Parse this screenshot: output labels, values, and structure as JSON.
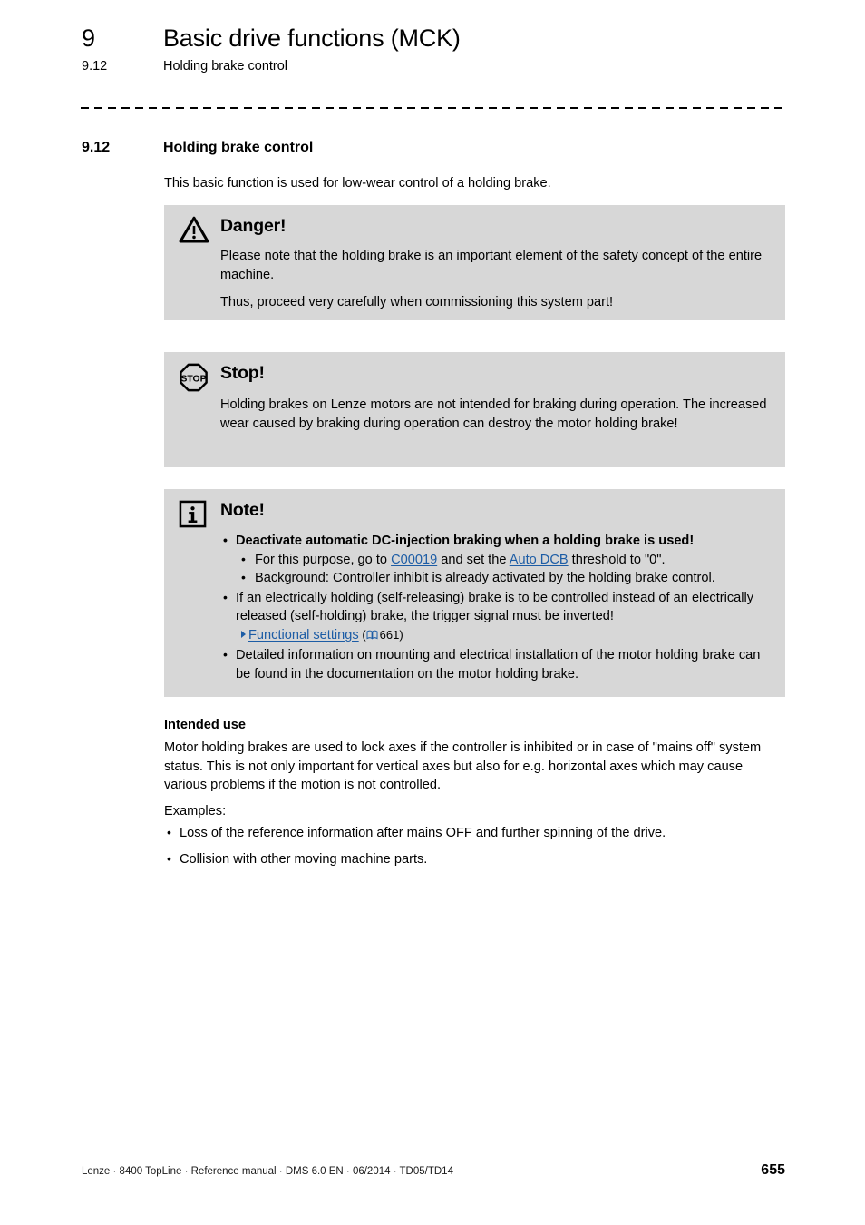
{
  "header": {
    "chapter_number": "9",
    "chapter_title": "Basic drive functions (MCK)",
    "section_number": "9.12",
    "section_title": "Holding brake control"
  },
  "section": {
    "number": "9.12",
    "title": "Holding brake control",
    "intro": "This basic function is used for low-wear control of a holding brake."
  },
  "callouts": {
    "danger": {
      "icon": "warning-triangle-icon",
      "title": "Danger!",
      "paragraphs": [
        "Please note that the holding brake is an important element of the safety concept of the entire machine.",
        "Thus, proceed very carefully when commissioning this system part!"
      ]
    },
    "stop": {
      "icon": "stop-sign-icon",
      "title": "Stop!",
      "paragraphs": [
        "Holding brakes on Lenze motors are not intended for braking during operation. The increased wear caused by braking during operation can destroy the motor holding brake!"
      ]
    },
    "note": {
      "icon": "info-icon",
      "title": "Note!",
      "item1": "Deactivate automatic DC-injection braking when a holding brake is used!",
      "item1_sub1_a": "For this purpose, go to ",
      "item1_sub1_link1": "C00019",
      "item1_sub1_b": " and set the ",
      "item1_sub1_link2": "Auto DCB",
      "item1_sub1_c": " threshold to \"0\".",
      "item1_sub2": "Background: Controller inhibit is already activated by the holding brake control.",
      "item2": "If an electrically holding (self-releasing) brake is to be controlled instead of an electrically released (self-holding) brake, the trigger signal must be inverted!",
      "item2_xref_link": "Functional settings",
      "item2_xref_page": "661",
      "item2_xref_open": "(",
      "item2_xref_close": ")",
      "item3": "Detailed information on mounting and electrical installation of the motor holding brake can be found in the documentation on the motor holding brake."
    }
  },
  "intended_use": {
    "heading": "Intended use",
    "paragraph": "Motor holding brakes are used to lock axes if the controller is inhibited or in case of \"mains off\" system status. This is not only important for vertical axes but also for e.g. horizontal axes which may cause various problems if the motion is not controlled.",
    "examples_label": "Examples:",
    "examples": [
      "Loss of the reference information after mains OFF and further spinning of the drive.",
      "Collision with other moving machine parts."
    ]
  },
  "footer": {
    "text": "Lenze · 8400 TopLine · Reference manual · DMS 6.0 EN · 06/2014 · TD05/TD14",
    "page_number": "655"
  },
  "colors": {
    "callout_background": "#d7d7d7",
    "link": "#1c5ca5",
    "text": "#000000"
  }
}
